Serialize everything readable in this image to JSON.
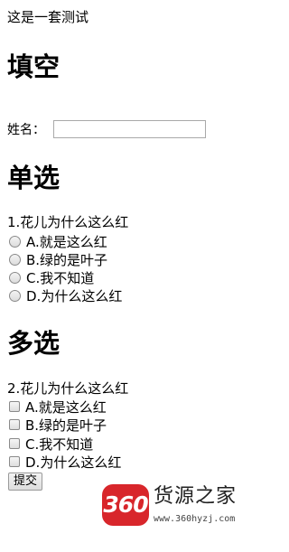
{
  "intro_text": "这是一套测试",
  "fill_section": {
    "heading": "填空",
    "name_label": "姓名：",
    "name_value": "",
    "name_placeholder": ""
  },
  "single_section": {
    "heading": "单选",
    "question": "1.花儿为什么这么红",
    "options": [
      {
        "label": "A.就是这么红",
        "checked": false
      },
      {
        "label": "B.绿的是叶子",
        "checked": false
      },
      {
        "label": "C.我不知道",
        "checked": false
      },
      {
        "label": "D.为什么这么红",
        "checked": false
      }
    ]
  },
  "multi_section": {
    "heading": "多选",
    "question": "2.花儿为什么这么红",
    "options": [
      {
        "label": "A.就是这么红",
        "checked": false
      },
      {
        "label": "B.绿的是叶子",
        "checked": false
      },
      {
        "label": "C.我不知道",
        "checked": false
      },
      {
        "label": "D.为什么这么红",
        "checked": false
      }
    ]
  },
  "submit_label": "提交",
  "watermark": {
    "badge_text": "360",
    "brand_text": "货源之家",
    "url_text": "www.360hyzj.com",
    "badge_color": "#d8262b"
  }
}
